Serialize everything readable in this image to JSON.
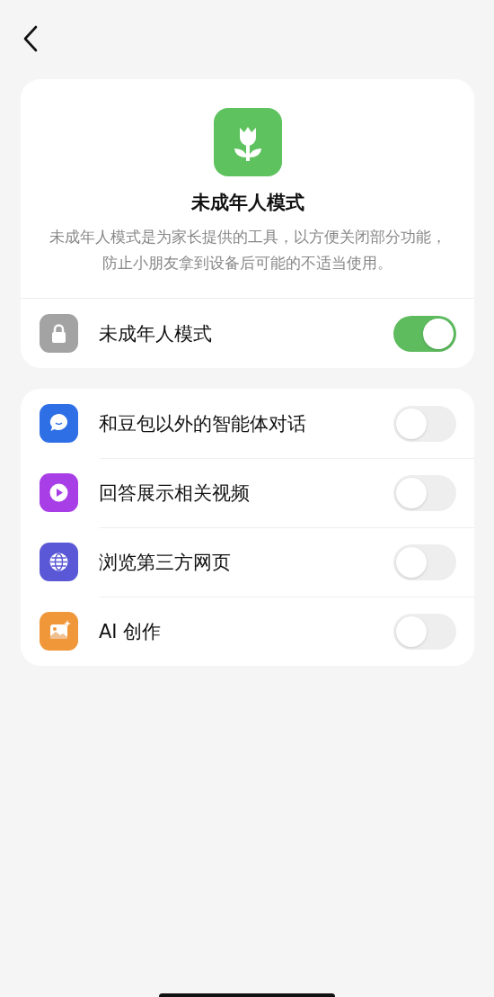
{
  "header": {
    "title": "未成年人模式",
    "description": "未成年人模式是为家长提供的工具，以方便关闭部分功能，防止小朋友拿到设备后可能的不适当使用。"
  },
  "main_toggle": {
    "kind": "lock",
    "label": "未成年人模式",
    "on": true,
    "color": "#a3a3a3"
  },
  "features": [
    {
      "kind": "chat",
      "label": "和豆包以外的智能体对话",
      "on": false,
      "color": "#2f6fe6"
    },
    {
      "kind": "video",
      "label": "回答展示相关视频",
      "on": false,
      "color": "#a83ee6"
    },
    {
      "kind": "web",
      "label": "浏览第三方网页",
      "on": false,
      "color": "#5a58d6"
    },
    {
      "kind": "image",
      "label": "AI 创作",
      "on": false,
      "color": "#f0973a"
    }
  ]
}
